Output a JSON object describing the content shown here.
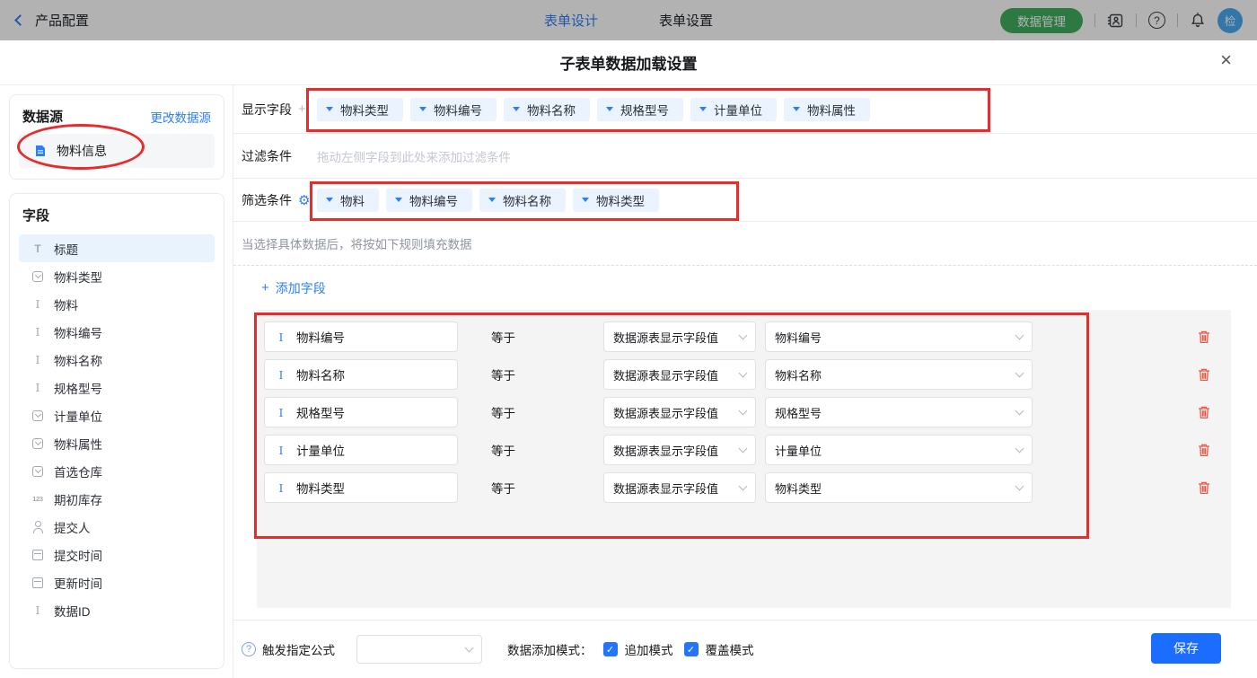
{
  "colors": {
    "accent_blue": "#2d7ff7",
    "tag_bg": "#eaf3fe",
    "green_button": "#3fae5d",
    "save_blue": "#1a6dff",
    "checkbox_blue": "#2475fc",
    "trash_red": "#f25643",
    "annotation_red": "#e62c2c"
  },
  "topbar": {
    "back_label": "产品配置",
    "tabs": [
      {
        "label": "表单设计",
        "active": true
      },
      {
        "label": "表单设置",
        "active": false
      }
    ],
    "data_manage_label": "数据管理",
    "avatar_text": "检"
  },
  "modal": {
    "title": "子表单数据加载设置"
  },
  "sidebar": {
    "datasource": {
      "title": "数据源",
      "change_link": "更改数据源",
      "item": "物料信息"
    },
    "fields": {
      "title": "字段",
      "items": [
        {
          "label": "标题",
          "icon": "title-icon",
          "selected": true
        },
        {
          "label": "物料类型",
          "icon": "select-icon"
        },
        {
          "label": "物料",
          "icon": "text-icon"
        },
        {
          "label": "物料编号",
          "icon": "text-icon"
        },
        {
          "label": "物料名称",
          "icon": "text-icon"
        },
        {
          "label": "规格型号",
          "icon": "text-icon"
        },
        {
          "label": "计量单位",
          "icon": "select-icon"
        },
        {
          "label": "物料属性",
          "icon": "select-icon"
        },
        {
          "label": "首选仓库",
          "icon": "select-icon"
        },
        {
          "label": "期初库存",
          "icon": "number-icon"
        },
        {
          "label": "提交人",
          "icon": "person-icon"
        },
        {
          "label": "提交时间",
          "icon": "date-icon"
        },
        {
          "label": "更新时间",
          "icon": "date-icon"
        },
        {
          "label": "数据ID",
          "icon": "text-icon"
        }
      ]
    }
  },
  "main": {
    "display_fields": {
      "label": "显示字段",
      "tags": [
        "物料类型",
        "物料编号",
        "物料名称",
        "规格型号",
        "计量单位",
        "物料属性"
      ]
    },
    "filter": {
      "label": "过滤条件",
      "placeholder": "拖动左侧字段到此处来添加过滤条件"
    },
    "screen_fields": {
      "label": "筛选条件",
      "tags": [
        "物料",
        "物料编号",
        "物料名称",
        "物料类型"
      ]
    },
    "hint": "当选择具体数据后，将按如下规则填充数据",
    "add_field_label": "添加字段",
    "rules": [
      {
        "field": "物料编号",
        "op": "等于",
        "source": "数据源表显示字段值",
        "target": "物料编号"
      },
      {
        "field": "物料名称",
        "op": "等于",
        "source": "数据源表显示字段值",
        "target": "物料名称"
      },
      {
        "field": "规格型号",
        "op": "等于",
        "source": "数据源表显示字段值",
        "target": "规格型号"
      },
      {
        "field": "计量单位",
        "op": "等于",
        "source": "数据源表显示字段值",
        "target": "计量单位"
      },
      {
        "field": "物料类型",
        "op": "等于",
        "source": "数据源表显示字段值",
        "target": "物料类型"
      }
    ]
  },
  "footer": {
    "formula_label": "触发指定公式",
    "formula_value": "",
    "mode_label": "数据添加模式：",
    "modes": [
      {
        "label": "追加模式",
        "checked": true
      },
      {
        "label": "覆盖模式",
        "checked": true
      }
    ],
    "save_label": "保存"
  }
}
